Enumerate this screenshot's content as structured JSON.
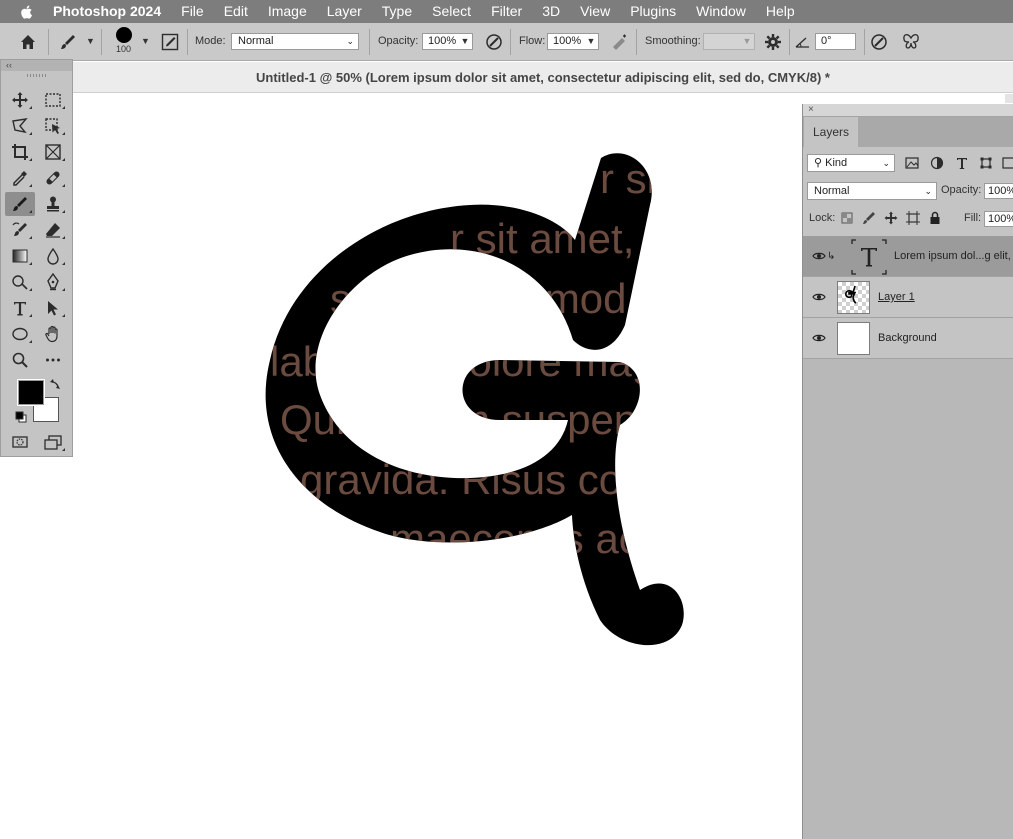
{
  "menubar": {
    "app_name": "Photoshop 2024",
    "items": [
      "File",
      "Edit",
      "Image",
      "Layer",
      "Type",
      "Select",
      "Filter",
      "3D",
      "View",
      "Plugins",
      "Window",
      "Help"
    ]
  },
  "options": {
    "brush_size": "100",
    "mode_label": "Mode:",
    "mode_value": "Normal",
    "opacity_label": "Opacity:",
    "opacity_value": "100%",
    "flow_label": "Flow:",
    "flow_value": "100%",
    "smoothing_label": "Smoothing:",
    "smoothing_value": "",
    "angle_value": "0°"
  },
  "document": {
    "title": "Untitled-1 @ 50% (Lorem ipsum dolor sit amet, consectetur adipiscing elit, sed do, CMYK/8) *"
  },
  "canvas": {
    "text_lines": [
      "r sit amet, consectetur adipiscing elit,",
      "sed do eiusmod tempor incididunt ut",
      "labore et dolore magna aliqua.",
      "Quis ipsum suspendisse ultrices",
      "gravida. Risus commodo viverra",
      "maecenas accumsan lacus vel"
    ],
    "text_color": "#6b4b3f",
    "glyph_color": "#000000"
  },
  "tools": {
    "collapse_glyph": "‹‹",
    "foreground_color": "#000000",
    "background_color": "#ffffff"
  },
  "layers_panel": {
    "close_glyph": "×",
    "tab_label": "Layers",
    "filter_value": "Kind",
    "blend_mode": "Normal",
    "opacity_label": "Opacity:",
    "opacity_value": "100%",
    "lock_label": "Lock:",
    "fill_label": "Fill:",
    "fill_value": "100%",
    "layers": [
      {
        "name": "Lorem ipsum dol...g elit, s",
        "kind": "type",
        "selected": true
      },
      {
        "name": "Layer 1",
        "kind": "pixel",
        "selected": false
      },
      {
        "name": "Background",
        "kind": "background",
        "selected": false
      }
    ]
  }
}
